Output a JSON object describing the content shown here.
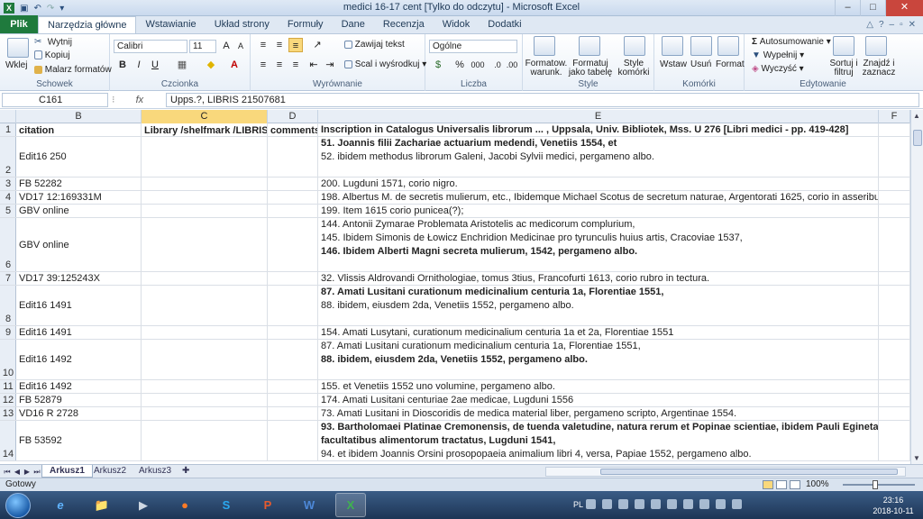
{
  "window": {
    "title": "medici 16-17 cent  [Tylko do odczytu]  -  Microsoft Excel",
    "controls": [
      "–",
      "□",
      "✕"
    ]
  },
  "ribbon_tabs": {
    "file": "Plik",
    "tabs": [
      "Narzędzia główne",
      "Wstawianie",
      "Układ strony",
      "Formuły",
      "Dane",
      "Recenzja",
      "Widok",
      "Dodatki"
    ],
    "active": "Narzędzia główne"
  },
  "ribbon": {
    "clipboard": {
      "paste": "Wklej",
      "cut": "Wytnij",
      "copy": "Kopiuj",
      "format_painter": "Malarz formatów",
      "label": "Schowek"
    },
    "font": {
      "name": "Calibri",
      "size": "11",
      "bold": "B",
      "italic": "I",
      "underline": "U",
      "label": "Czcionka"
    },
    "alignment": {
      "wrap": "Zawijaj tekst",
      "merge": "Scal i wyśrodkuj",
      "label": "Wyrównanie"
    },
    "number": {
      "format": "Ogólne",
      "percent": "%",
      "thousands": "000",
      "label": "Liczba"
    },
    "styles": {
      "conditional": "Formatow. warunk.",
      "as_table": "Formatuj jako tabelę",
      "cell_styles": "Style komórki",
      "label": "Style"
    },
    "cells": {
      "insert": "Wstaw",
      "delete": "Usuń",
      "format": "Format",
      "label": "Komórki"
    },
    "editing": {
      "autosum": "Autosumowanie",
      "fill": "Wypełnij",
      "clear": "Wyczyść",
      "sort": "Sortuj i filtruj",
      "find": "Znajdź i zaznacz",
      "label": "Edytowanie"
    }
  },
  "formula_bar": {
    "name_box": "C161",
    "fx": "fx",
    "formula": "Upps.?, LIBRIS 21507681"
  },
  "columns": [
    {
      "id": "B",
      "selected": false
    },
    {
      "id": "C",
      "selected": true
    },
    {
      "id": "D",
      "selected": false
    },
    {
      "id": "E",
      "selected": false
    },
    {
      "id": "F",
      "selected": false
    }
  ],
  "rows": [
    {
      "num": "1",
      "b": "citation",
      "c": "Library /shelfmark /LIBRIS nr",
      "d": "comments",
      "e": [
        {
          "text": "Inscription in Catalogus Universalis librorum ... , Uppsala, Univ. Bibliotek, Mss. U 276 [Libri medici  - pp. 419-428]",
          "bold": true
        }
      ],
      "header": true
    },
    {
      "num": "2",
      "b": "Edit16 250",
      "c": "",
      "d": "",
      "e": [
        {
          "text": "51. Joannis filii Zachariae actuarium medendi, Venetiis 1554, et",
          "bold": true
        },
        {
          "text": "52. ibidem methodus librorum Galeni, Jacobi Sylvii medici, pergameno albo.",
          "bold": false
        },
        {
          "text": "",
          "bold": false
        }
      ]
    },
    {
      "num": "3",
      "b": "FB 52282",
      "c": "",
      "d": "",
      "e": [
        {
          "text": "200. Lugduni 1571, corio nigro.",
          "bold": false
        }
      ]
    },
    {
      "num": "4",
      "b": "VD17 12:169331M",
      "c": "",
      "d": "",
      "e": [
        {
          "text": "198. Albertus M. de secretis mulierum, etc., Ibidemque Michael Scotus de secretum naturae, Argentorati 1625, corio in asseribus albo;",
          "bold": false
        }
      ]
    },
    {
      "num": "5",
      "b": "GBV online",
      "c": "",
      "d": "",
      "e": [
        {
          "text": "199. Item 1615 corio punicea(?);",
          "bold": false
        }
      ]
    },
    {
      "num": "6",
      "b": "GBV online",
      "c": "",
      "d": "",
      "e": [
        {
          "text": "144. Antonii Zymarae Problemata Aristotelis ac medicorum complurium,",
          "bold": false
        },
        {
          "text": "145. Ibidem Simonis de Łowicz Enchridion Medicinae pro tyrunculis huius artis, Cracoviae 1537,",
          "bold": false
        },
        {
          "text": "146. Ibidem Alberti Magni secreta mulierum, 1542, pergameno albo.",
          "bold": true
        },
        {
          "text": "",
          "bold": false
        }
      ]
    },
    {
      "num": "7",
      "b": "VD17 39:125243X",
      "c": "",
      "d": "",
      "e": [
        {
          "text": "32. Vlissis Aldrovandi Ornithologiae, tomus 3tius, Francofurti 1613, corio rubro in tectura.",
          "bold": false
        }
      ]
    },
    {
      "num": "8",
      "b": "Edit16 1491",
      "c": "",
      "d": "",
      "e": [
        {
          "text": "87. Amati Lusitani curationum medicinalium centuria 1a, Florentiae 1551,",
          "bold": true
        },
        {
          "text": "88. ibidem, eiusdem 2da, Venetiis 1552, pergameno albo.",
          "bold": false
        },
        {
          "text": "",
          "bold": false
        }
      ]
    },
    {
      "num": "9",
      "b": "Edit16 1491",
      "c": "",
      "d": "",
      "e": [
        {
          "text": "154. Amati Lusytani, curationum medicinalium centuria 1a et 2a, Florentiae 1551",
          "bold": false
        }
      ]
    },
    {
      "num": "10",
      "b": "Edit16 1492",
      "c": "",
      "d": "",
      "e": [
        {
          "text": "87. Amati Lusitani curationum medicinalium centuria 1a, Florentiae 1551,",
          "bold": false
        },
        {
          "text": "88. ibidem, eiusdem 2da, Venetiis 1552, pergameno albo.",
          "bold": true
        },
        {
          "text": "",
          "bold": false
        }
      ]
    },
    {
      "num": "11",
      "b": "Edit16 1492",
      "c": "",
      "d": "",
      "e": [
        {
          "text": "155. et Venetiis 1552 uno volumine, pergameno albo.",
          "bold": false
        }
      ]
    },
    {
      "num": "12",
      "b": "FB 52879",
      "c": "",
      "d": "",
      "e": [
        {
          "text": "174. Amati Lusitani centuriae 2ae medicae, Lugduni 1556",
          "bold": false
        }
      ]
    },
    {
      "num": "13",
      "b": "VD16 R 2728",
      "c": "",
      "d": "",
      "e": [
        {
          "text": "73. Amati Lusitani in Dioscoridis de medica material liber, pergameno scripto, Argentinae 1554.",
          "bold": false
        }
      ]
    },
    {
      "num": "14",
      "b": "FB 53592",
      "c": "",
      "d": "",
      "e": [
        {
          "text": "93. Bartholomaei Platinae Cremonensis, de tuenda valetudine, natura rerum et Popinae scientiae, ibidem Pauli Eginetae de",
          "bold": true
        },
        {
          "text": "facultatibus alimentorum tractatus, Lugduni 1541,",
          "bold": true
        },
        {
          "text": "94. et ibidem Joannis Orsini prosopopaeia animalium libri 4, versa, Papiae 1552, pergameno albo.",
          "bold": false
        }
      ]
    }
  ],
  "sheet_tabs": [
    "Arkusz1",
    "Arkusz2",
    "Arkusz3"
  ],
  "active_sheet": "Arkusz1",
  "status": {
    "ready": "Gotowy",
    "zoom": "100%"
  },
  "taskbar": {
    "lang": "PL",
    "time": "23:16",
    "date": "2018-10-11",
    "apps": [
      "e",
      "📁",
      "●",
      "S",
      "P",
      "W",
      "X"
    ]
  }
}
